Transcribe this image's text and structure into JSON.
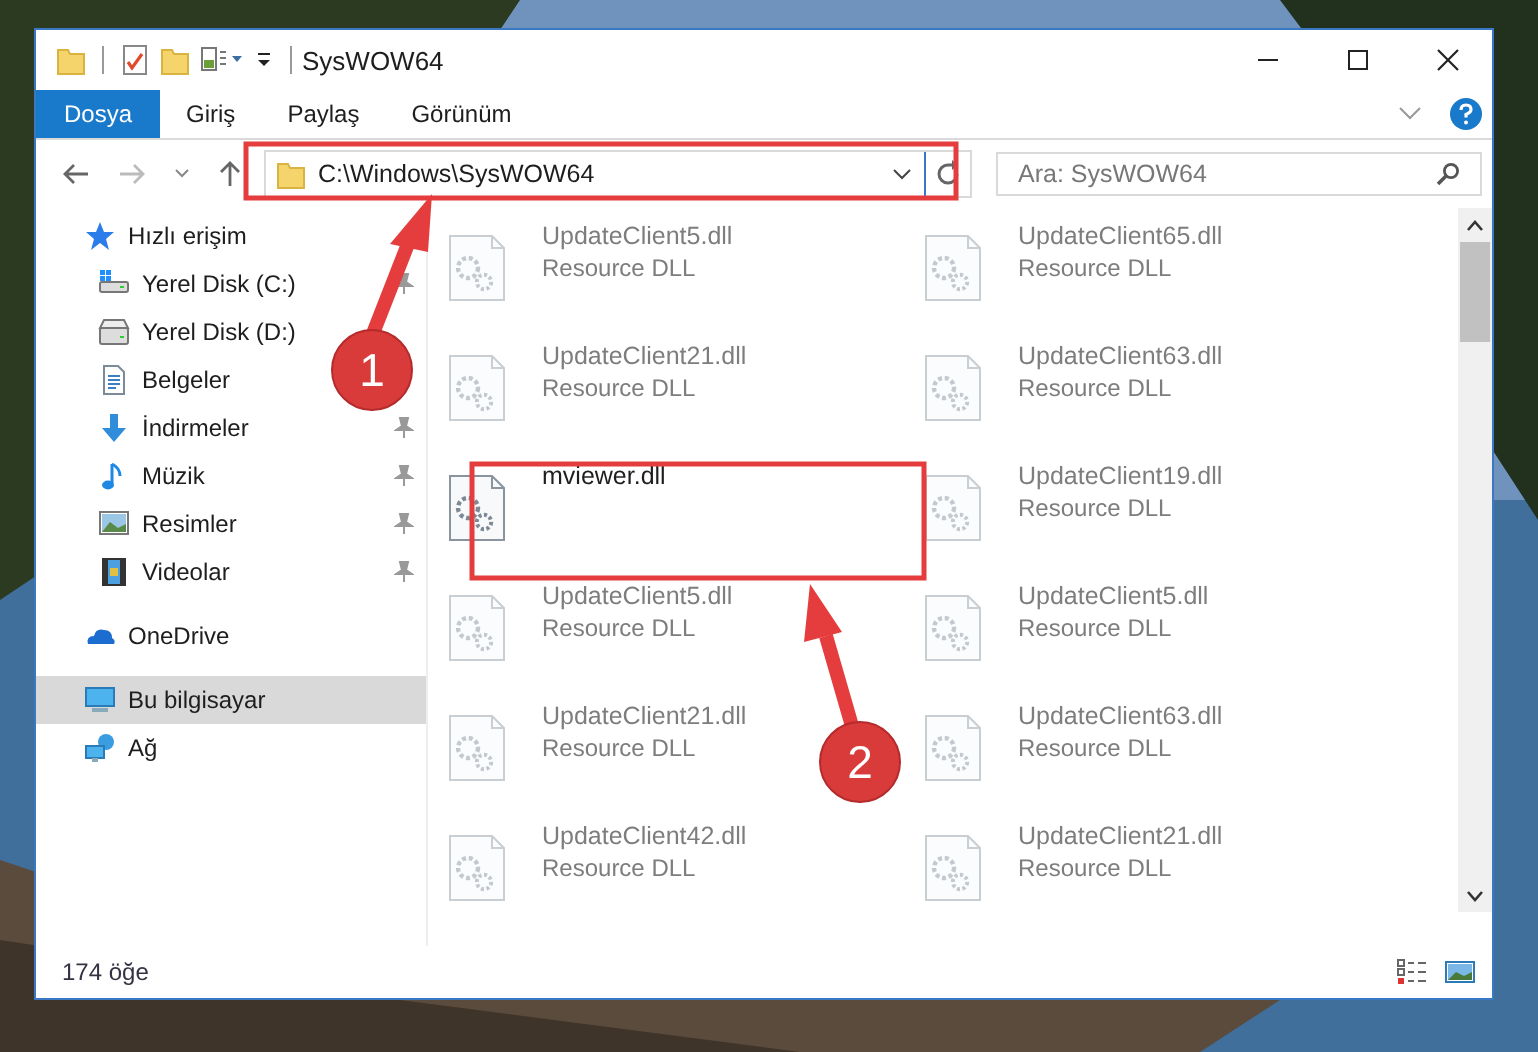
{
  "window": {
    "title": "SysWOW64"
  },
  "ribbon_tabs": [
    {
      "label": "Dosya",
      "selected": true
    },
    {
      "label": "Giriş",
      "selected": false
    },
    {
      "label": "Paylaş",
      "selected": false
    },
    {
      "label": "Görünüm",
      "selected": false
    }
  ],
  "address": {
    "value": "C:\\Windows\\SysWOW64"
  },
  "search": {
    "placeholder": "Ara: SysWOW64"
  },
  "sidebar": {
    "items": [
      {
        "label": "Hızlı erişim",
        "selected": false,
        "children": [
          {
            "label": "Yerel Disk (C:)",
            "pinned": true
          },
          {
            "label": "Yerel Disk (D:)",
            "pinned": false
          },
          {
            "label": "Belgeler",
            "pinned": false
          },
          {
            "label": "İndirmeler",
            "pinned": true
          },
          {
            "label": "Müzik",
            "pinned": true
          },
          {
            "label": "Resimler",
            "pinned": true
          },
          {
            "label": "Videolar",
            "pinned": true
          }
        ]
      },
      {
        "label": "OneDrive",
        "selected": false
      },
      {
        "label": "Bu bilgisayar",
        "selected": true
      },
      {
        "label": "Ağ",
        "selected": false
      }
    ]
  },
  "files": [
    {
      "name": "UpdateClient5.dll",
      "type": "Resource DLL",
      "blurred": true
    },
    {
      "name": "UpdateClient65.dll",
      "type": "Resource DLL",
      "blurred": true
    },
    {
      "name": "UpdateClient21.dll",
      "type": "Resource DLL",
      "blurred": true
    },
    {
      "name": "UpdateClient63.dll",
      "type": "Resource DLL",
      "blurred": true
    },
    {
      "name": "mviewer.dll",
      "blurred": false
    },
    {
      "name": "UpdateClient19.dll",
      "type": "Resource DLL",
      "blurred": true
    },
    {
      "name": "UpdateClient5.dll",
      "type": "Resource DLL",
      "blurred": true
    },
    {
      "name": "UpdateClient5.dll",
      "type": "Resource DLL",
      "blurred": true
    },
    {
      "name": "UpdateClient21.dll",
      "type": "Resource DLL",
      "blurred": true
    },
    {
      "name": "UpdateClient63.dll",
      "type": "Resource DLL",
      "blurred": true
    },
    {
      "name": "UpdateClient42.dll",
      "type": "Resource DLL",
      "blurred": true
    },
    {
      "name": "UpdateClient21.dll",
      "type": "Resource DLL",
      "blurred": true
    }
  ],
  "status_bar": {
    "text": "174 öğe"
  },
  "callouts": [
    {
      "label": "1"
    },
    {
      "label": "2"
    }
  ]
}
